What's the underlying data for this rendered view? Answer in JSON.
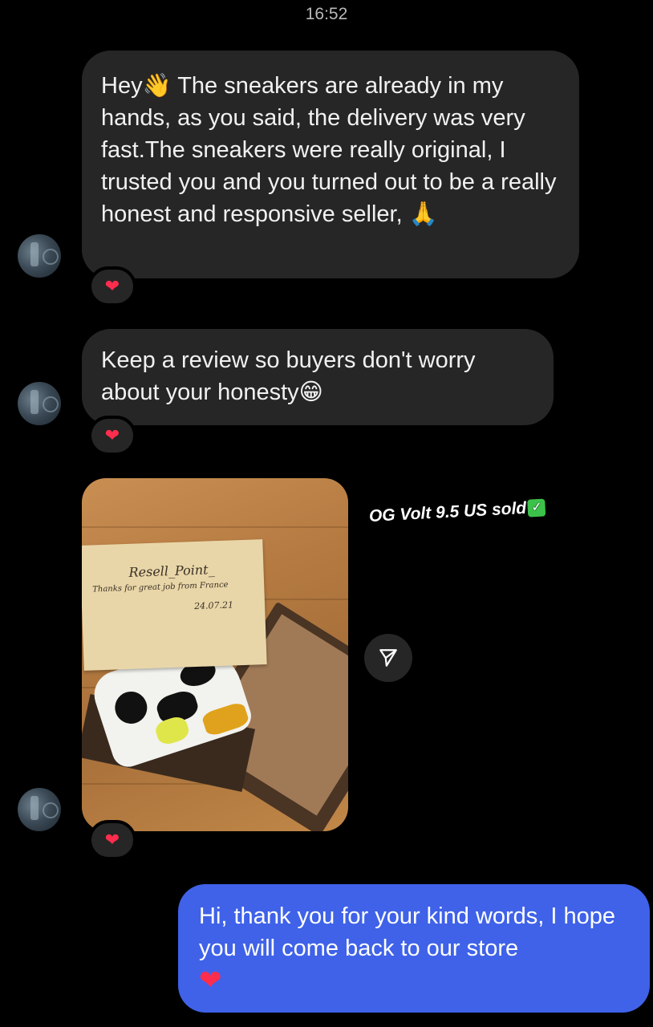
{
  "status": {
    "time": "16:52"
  },
  "messages": [
    {
      "text": "Hey👋 The sneakers are already in my hands, as you said, the delivery was very fast.The sneakers were really original, I trusted you and you turned out to be a really honest and responsive seller, 🙏",
      "reaction": "❤"
    },
    {
      "text": "Keep a review so buyers don't worry about your honesty😁",
      "reaction": "❤"
    },
    {
      "photo": {
        "note_line1": "Resell_Point_",
        "note_line2": "Thanks for great job from France",
        "note_date": "24.07.21"
      },
      "caption": "OG Volt 9.5 US sold",
      "caption_check": "✓",
      "reaction": "❤"
    }
  ],
  "outgoing": {
    "text": "Hi, thank you for your kind words, I hope you will come back to our store",
    "emoji": "❤"
  },
  "colors": {
    "incoming_bubble": "#262626",
    "outgoing_bubble": "#3f62e8",
    "heart": "#ff2d4d"
  },
  "icons": {
    "share": "send-icon",
    "avatar": "sender-avatar"
  }
}
